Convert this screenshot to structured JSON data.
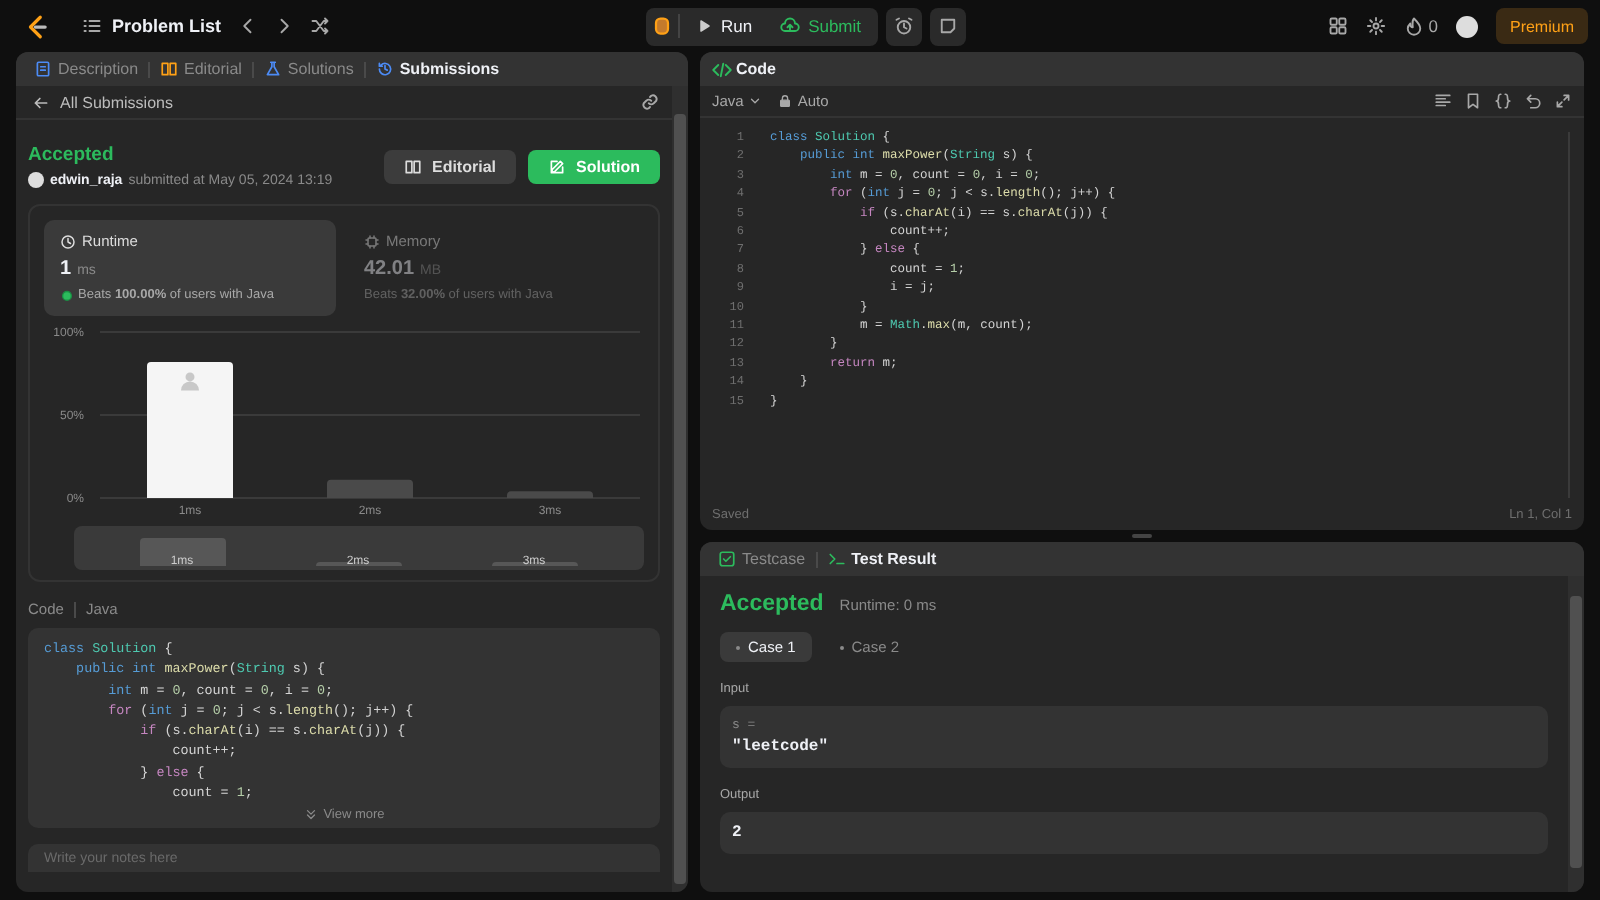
{
  "topbar": {
    "nav_title": "Problem List",
    "run": "Run",
    "submit": "Submit",
    "streak": "0",
    "premium": "Premium"
  },
  "left_tabs": [
    {
      "label": "Description",
      "selected": false
    },
    {
      "label": "Editorial",
      "selected": false
    },
    {
      "label": "Solutions",
      "selected": false
    },
    {
      "label": "Submissions",
      "selected": true
    }
  ],
  "back_link": "All Submissions",
  "submission": {
    "status": "Accepted",
    "user": "edwin_raja",
    "submitted": "submitted at May 05, 2024 13:19",
    "buttons": [
      {
        "label": "Editorial",
        "kind": "secondary"
      },
      {
        "label": "Solution",
        "kind": "primary"
      }
    ]
  },
  "stats": [
    {
      "title": "Runtime",
      "value": "1",
      "unit": "ms",
      "beats": "Beats **100.00%** of users with Java",
      "selected": true
    },
    {
      "title": "Memory",
      "value": "42.01",
      "unit": "MB",
      "beats": "Beats **32.00%** of users with Java",
      "selected": false
    }
  ],
  "chart_data": {
    "type": "bar",
    "categories": [
      "1ms",
      "2ms",
      "3ms"
    ],
    "values": [
      82,
      11,
      4
    ],
    "ylim": [
      0,
      100
    ],
    "yticks": [
      {
        "value": 0,
        "label": "0%"
      },
      {
        "value": 50,
        "label": "50%"
      },
      {
        "value": 100,
        "label": "100%"
      }
    ]
  },
  "overview_labels": [
    "1ms",
    "2ms",
    "3ms"
  ],
  "code_view": {
    "label": "Code",
    "language": "Java",
    "more": "View more",
    "lines": [
      {
        "tokens": [
          {
            "kind": "keyword",
            "text": "class "
          },
          {
            "kind": "type",
            "text": "Solution"
          },
          {
            "kind": "plain",
            "text": " {"
          }
        ]
      },
      {
        "tokens": [
          {
            "kind": "keyword",
            "text": "    public int "
          },
          {
            "kind": "function",
            "text": "maxPower"
          },
          {
            "kind": "plain",
            "text": "("
          },
          {
            "kind": "type",
            "text": "String"
          },
          {
            "kind": "plain",
            "text": " s) {"
          }
        ]
      },
      {
        "tokens": [
          {
            "kind": "keyword",
            "text": "        int "
          },
          {
            "kind": "plain",
            "text": "m = "
          },
          {
            "kind": "number",
            "text": "0"
          },
          {
            "kind": "plain",
            "text": ", count = "
          },
          {
            "kind": "number",
            "text": "0"
          },
          {
            "kind": "plain",
            "text": ", i = "
          },
          {
            "kind": "number",
            "text": "0"
          },
          {
            "kind": "plain",
            "text": ";"
          }
        ]
      },
      {
        "tokens": [
          {
            "kind": "control",
            "text": "        for "
          },
          {
            "kind": "plain",
            "text": "("
          },
          {
            "kind": "keyword",
            "text": "int "
          },
          {
            "kind": "plain",
            "text": "j = "
          },
          {
            "kind": "number",
            "text": "0"
          },
          {
            "kind": "plain",
            "text": "; j < s."
          },
          {
            "kind": "function",
            "text": "length"
          },
          {
            "kind": "plain",
            "text": "(); j++) {"
          }
        ]
      },
      {
        "tokens": [
          {
            "kind": "control",
            "text": "            if "
          },
          {
            "kind": "plain",
            "text": "(s."
          },
          {
            "kind": "function",
            "text": "charAt"
          },
          {
            "kind": "plain",
            "text": "(i) == s."
          },
          {
            "kind": "function",
            "text": "charAt"
          },
          {
            "kind": "plain",
            "text": "(j)) {"
          }
        ]
      },
      {
        "tokens": [
          {
            "kind": "plain",
            "text": "                count++;"
          }
        ]
      },
      {
        "tokens": [
          {
            "kind": "plain",
            "text": "            } "
          },
          {
            "kind": "control",
            "text": "else"
          },
          {
            "kind": "plain",
            "text": " {"
          }
        ]
      },
      {
        "tokens": [
          {
            "kind": "plain",
            "text": "                count = "
          },
          {
            "kind": "number",
            "text": "1"
          },
          {
            "kind": "plain",
            "text": ";"
          }
        ]
      }
    ]
  },
  "notes": {
    "placeholder": "Write your notes here"
  },
  "editor": {
    "title": "Code",
    "language": "Java",
    "mode": "Auto",
    "status": "Saved",
    "cursor": "Ln 1, Col 1",
    "lines": [
      {
        "n": "1",
        "tokens": [
          {
            "kind": "keyword",
            "text": "class "
          },
          {
            "kind": "type",
            "text": "Solution"
          },
          {
            "kind": "plain",
            "text": " {"
          }
        ]
      },
      {
        "n": "2",
        "tokens": [
          {
            "kind": "keyword",
            "text": "    public int "
          },
          {
            "kind": "function",
            "text": "maxPower"
          },
          {
            "kind": "plain",
            "text": "("
          },
          {
            "kind": "type",
            "text": "String"
          },
          {
            "kind": "plain",
            "text": " s) {"
          }
        ]
      },
      {
        "n": "3",
        "tokens": [
          {
            "kind": "keyword",
            "text": "        int "
          },
          {
            "kind": "plain",
            "text": "m = "
          },
          {
            "kind": "number",
            "text": "0"
          },
          {
            "kind": "plain",
            "text": ", count = "
          },
          {
            "kind": "number",
            "text": "0"
          },
          {
            "kind": "plain",
            "text": ", i = "
          },
          {
            "kind": "number",
            "text": "0"
          },
          {
            "kind": "plain",
            "text": ";"
          }
        ]
      },
      {
        "n": "4",
        "tokens": [
          {
            "kind": "control",
            "text": "        for "
          },
          {
            "kind": "plain",
            "text": "("
          },
          {
            "kind": "keyword",
            "text": "int "
          },
          {
            "kind": "plain",
            "text": "j = "
          },
          {
            "kind": "number",
            "text": "0"
          },
          {
            "kind": "plain",
            "text": "; j < s."
          },
          {
            "kind": "function",
            "text": "length"
          },
          {
            "kind": "plain",
            "text": "(); j++) {"
          }
        ]
      },
      {
        "n": "5",
        "tokens": [
          {
            "kind": "control",
            "text": "            if "
          },
          {
            "kind": "plain",
            "text": "(s."
          },
          {
            "kind": "function",
            "text": "charAt"
          },
          {
            "kind": "plain",
            "text": "(i) == s."
          },
          {
            "kind": "function",
            "text": "charAt"
          },
          {
            "kind": "plain",
            "text": "(j)) {"
          }
        ]
      },
      {
        "n": "6",
        "tokens": [
          {
            "kind": "plain",
            "text": "                count++;"
          }
        ]
      },
      {
        "n": "7",
        "tokens": [
          {
            "kind": "plain",
            "text": "            } "
          },
          {
            "kind": "control",
            "text": "else"
          },
          {
            "kind": "plain",
            "text": " {"
          }
        ]
      },
      {
        "n": "8",
        "tokens": [
          {
            "kind": "plain",
            "text": "                count = "
          },
          {
            "kind": "number",
            "text": "1"
          },
          {
            "kind": "plain",
            "text": ";"
          }
        ]
      },
      {
        "n": "9",
        "tokens": [
          {
            "kind": "plain",
            "text": "                i = j;"
          }
        ]
      },
      {
        "n": "10",
        "tokens": [
          {
            "kind": "plain",
            "text": "            }"
          }
        ]
      },
      {
        "n": "11",
        "tokens": [
          {
            "kind": "plain",
            "text": "            m = "
          },
          {
            "kind": "type",
            "text": "Math"
          },
          {
            "kind": "plain",
            "text": "."
          },
          {
            "kind": "function",
            "text": "max"
          },
          {
            "kind": "plain",
            "text": "(m, count);"
          }
        ]
      },
      {
        "n": "12",
        "tokens": [
          {
            "kind": "plain",
            "text": "        }"
          }
        ]
      },
      {
        "n": "13",
        "tokens": [
          {
            "kind": "control",
            "text": "        return "
          },
          {
            "kind": "plain",
            "text": "m;"
          }
        ]
      },
      {
        "n": "14",
        "tokens": [
          {
            "kind": "plain",
            "text": "    }"
          }
        ]
      },
      {
        "n": "15",
        "tokens": [
          {
            "kind": "plain",
            "text": "}"
          }
        ]
      }
    ]
  },
  "results": {
    "tabs": [
      {
        "label": "Testcase",
        "selected": false
      },
      {
        "label": "Test Result",
        "selected": true
      }
    ],
    "status": "Accepted",
    "runtime": "Runtime: 0 ms",
    "cases": [
      {
        "label": "Case 1",
        "selected": true
      },
      {
        "label": "Case 2",
        "selected": false
      }
    ],
    "input_label": "Input",
    "inputs": [
      {
        "name": "s =",
        "value": "\"leetcode\""
      }
    ],
    "output_label": "Output",
    "output": "2"
  }
}
